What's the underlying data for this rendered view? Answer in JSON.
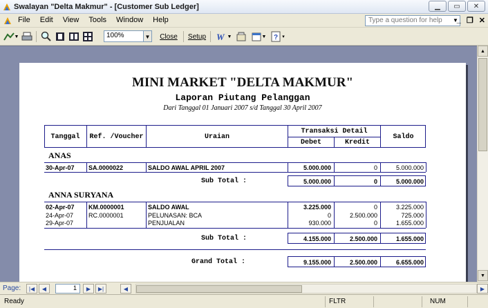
{
  "window": {
    "title": "Swalayan \"Delta Makmur\" - [Customer Sub Ledger]"
  },
  "menu": {
    "items": [
      "File",
      "Edit",
      "View",
      "Tools",
      "Window",
      "Help"
    ],
    "help_placeholder": "Type a question for help"
  },
  "toolbar": {
    "zoom": "100%",
    "close_label": "Close",
    "setup_label": "Setup"
  },
  "report": {
    "title": "MINI MARKET \"DELTA MAKMUR\"",
    "subtitle": "Laporan Piutang Pelanggan",
    "date_range": "Dari Tanggal  01 Januari 2007 s/d Tanggal  30 April 2007",
    "headers": {
      "tanggal": "Tanggal",
      "ref": "Ref. /Voucher",
      "uraian": "Uraian",
      "transaksi": "Transaksi Detail",
      "debet": "Debet",
      "kredit": "Kredit",
      "saldo": "Saldo"
    },
    "groups": [
      {
        "name": "ANAS",
        "rows": [
          {
            "tanggal": "30-Apr-07",
            "ref": "SA.0000022",
            "uraian": "SALDO AWAL APRIL 2007",
            "debet": "5.000.000",
            "kredit": "0",
            "saldo": "5.000.000"
          }
        ],
        "subtotal": {
          "label": "Sub Total  :",
          "debet": "5.000.000",
          "kredit": "0",
          "saldo": "5.000.000"
        }
      },
      {
        "name": "ANNA SURYANA",
        "rows": [
          {
            "tanggal": "02-Apr-07",
            "ref": "KM.0000001",
            "uraian": "SALDO AWAL",
            "debet": "3.225.000",
            "kredit": "0",
            "saldo": "3.225.000"
          },
          {
            "tanggal": "24-Apr-07",
            "ref": "RC.0000001",
            "uraian": "PELUNASAN: BCA",
            "debet": "0",
            "kredit": "2.500.000",
            "saldo": "725.000"
          },
          {
            "tanggal": "29-Apr-07",
            "ref": "",
            "uraian": "PENJUALAN",
            "debet": "930.000",
            "kredit": "0",
            "saldo": "1.655.000"
          }
        ],
        "subtotal": {
          "label": "Sub Total  :",
          "debet": "4.155.000",
          "kredit": "2.500.000",
          "saldo": "1.655.000"
        }
      }
    ],
    "grand_total": {
      "label": "Grand Total  :",
      "debet": "9.155.000",
      "kredit": "2.500.000",
      "saldo": "6.655.000"
    }
  },
  "nav": {
    "page_label": "Page:",
    "page_number": "1"
  },
  "status": {
    "left": "Ready",
    "fltr": "FLTR",
    "num": "NUM"
  }
}
